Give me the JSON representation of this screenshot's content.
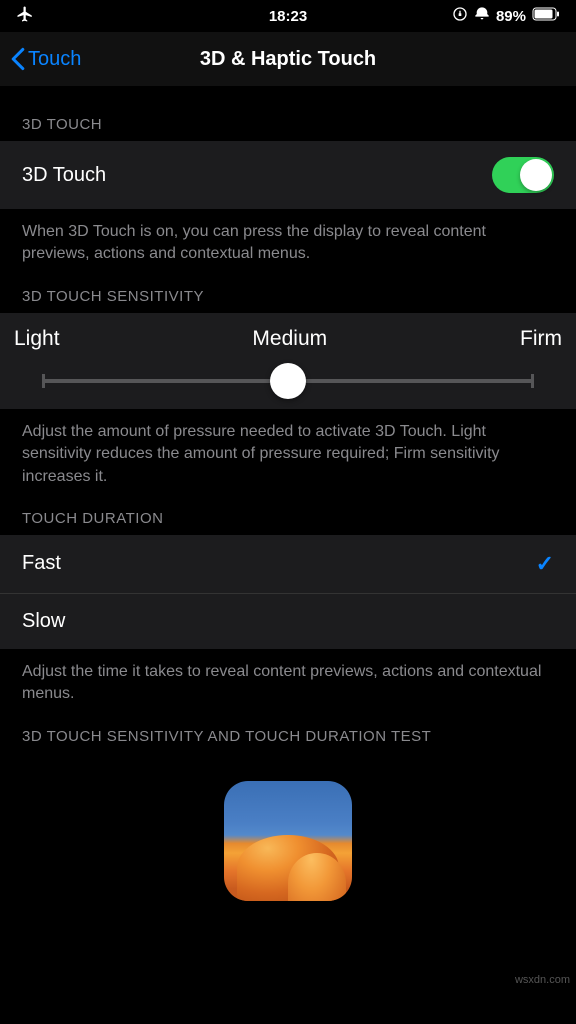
{
  "status": {
    "time": "18:23",
    "battery": "89%"
  },
  "nav": {
    "back": "Touch",
    "title": "3D & Haptic Touch"
  },
  "sections": {
    "s1": {
      "header": "3D TOUCH"
    },
    "s2": {
      "header": "3D TOUCH SENSITIVITY"
    },
    "s3": {
      "header": "TOUCH DURATION"
    },
    "s4": {
      "header": "3D TOUCH SENSITIVITY AND TOUCH DURATION TEST"
    }
  },
  "toggle": {
    "label": "3D Touch",
    "footer": "When 3D Touch is on, you can press the display to reveal content previews, actions and contextual menus."
  },
  "slider": {
    "light": "Light",
    "medium": "Medium",
    "firm": "Firm",
    "footer": "Adjust the amount of pressure needed to activate 3D Touch. Light sensitivity reduces the amount of pressure required; Firm sensitivity increases it."
  },
  "duration": {
    "fast": "Fast",
    "slow": "Slow",
    "footer": "Adjust the time it takes to reveal content previews, actions and contextual menus."
  },
  "watermark": "wsxdn.com"
}
